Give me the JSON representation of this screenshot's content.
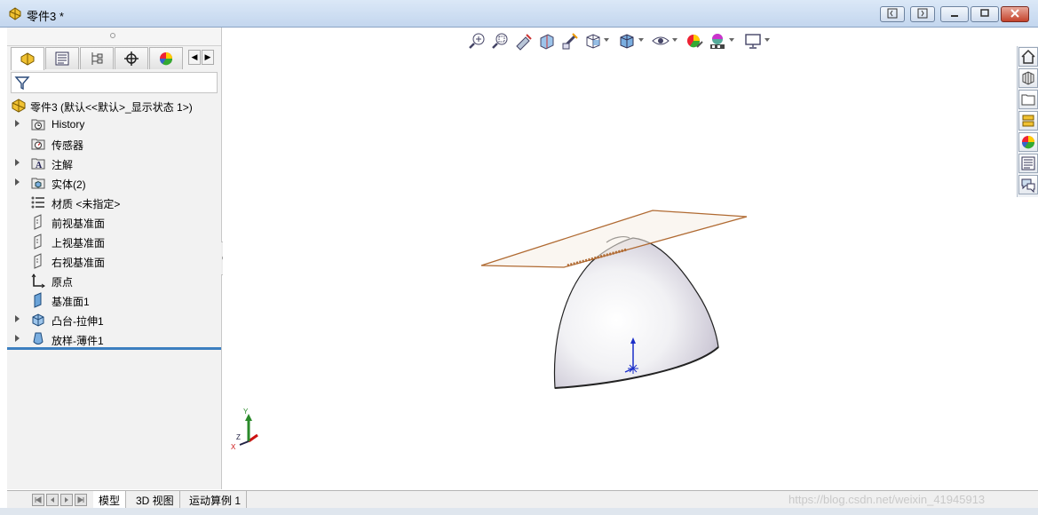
{
  "window": {
    "title": "零件3 *",
    "controls": [
      "restore-down-left",
      "restore-down-right",
      "minimize",
      "maximize",
      "close"
    ]
  },
  "feature_manager": {
    "tabs": [
      "feature-manager",
      "property-manager",
      "configuration-manager",
      "dimxpert-manager",
      "display-manager"
    ],
    "root_label": "零件3  (默认<<默认>_显示状态 1>)",
    "items": [
      {
        "label": "History",
        "icon": "history-icon",
        "expandable": true
      },
      {
        "label": "传感器",
        "icon": "sensor-icon",
        "expandable": false
      },
      {
        "label": "注解",
        "icon": "annotation-icon",
        "expandable": true
      },
      {
        "label": "实体(2)",
        "icon": "solid-bodies-icon",
        "expandable": true
      },
      {
        "label": "材质 <未指定>",
        "icon": "material-icon",
        "expandable": false
      },
      {
        "label": "前视基准面",
        "icon": "plane-icon",
        "expandable": false
      },
      {
        "label": "上视基准面",
        "icon": "plane-icon",
        "expandable": false
      },
      {
        "label": "右视基准面",
        "icon": "plane-icon",
        "expandable": false
      },
      {
        "label": "原点",
        "icon": "origin-icon",
        "expandable": false
      },
      {
        "label": "基准面1",
        "icon": "plane-feature-icon",
        "expandable": false
      },
      {
        "label": "凸台-拉伸1",
        "icon": "extrude-icon",
        "expandable": true
      },
      {
        "label": "放样-薄件1",
        "icon": "loft-icon",
        "expandable": true
      }
    ]
  },
  "heads_up_toolbar": [
    "zoom-to-fit-icon",
    "zoom-to-area-icon",
    "previous-view-icon",
    "section-view-icon",
    "dynamic-annotation-icon",
    "view-orientation-icon",
    "display-style-icon",
    "hide-show-icon",
    "edit-appearance-icon",
    "apply-scene-icon",
    "view-settings-icon"
  ],
  "task_pane": [
    "home-icon",
    "3d-content-icon",
    "design-library-icon",
    "file-explorer-icon",
    "appearances-icon",
    "custom-properties-icon",
    "forum-icon"
  ],
  "bottom_tabs": {
    "items": [
      "模型",
      "3D 视图",
      "运动算例 1"
    ],
    "active": 0
  },
  "triad_labels": {
    "x": "X",
    "y": "Y",
    "z": "Z"
  },
  "watermark": "https://blog.csdn.net/weixin_41945913",
  "colors": {
    "plane_edge": "#b06a32",
    "plane_fill": "#f6efe6",
    "rollback_bar": "#3c7fc0",
    "titlebar": "#c8daf0"
  }
}
